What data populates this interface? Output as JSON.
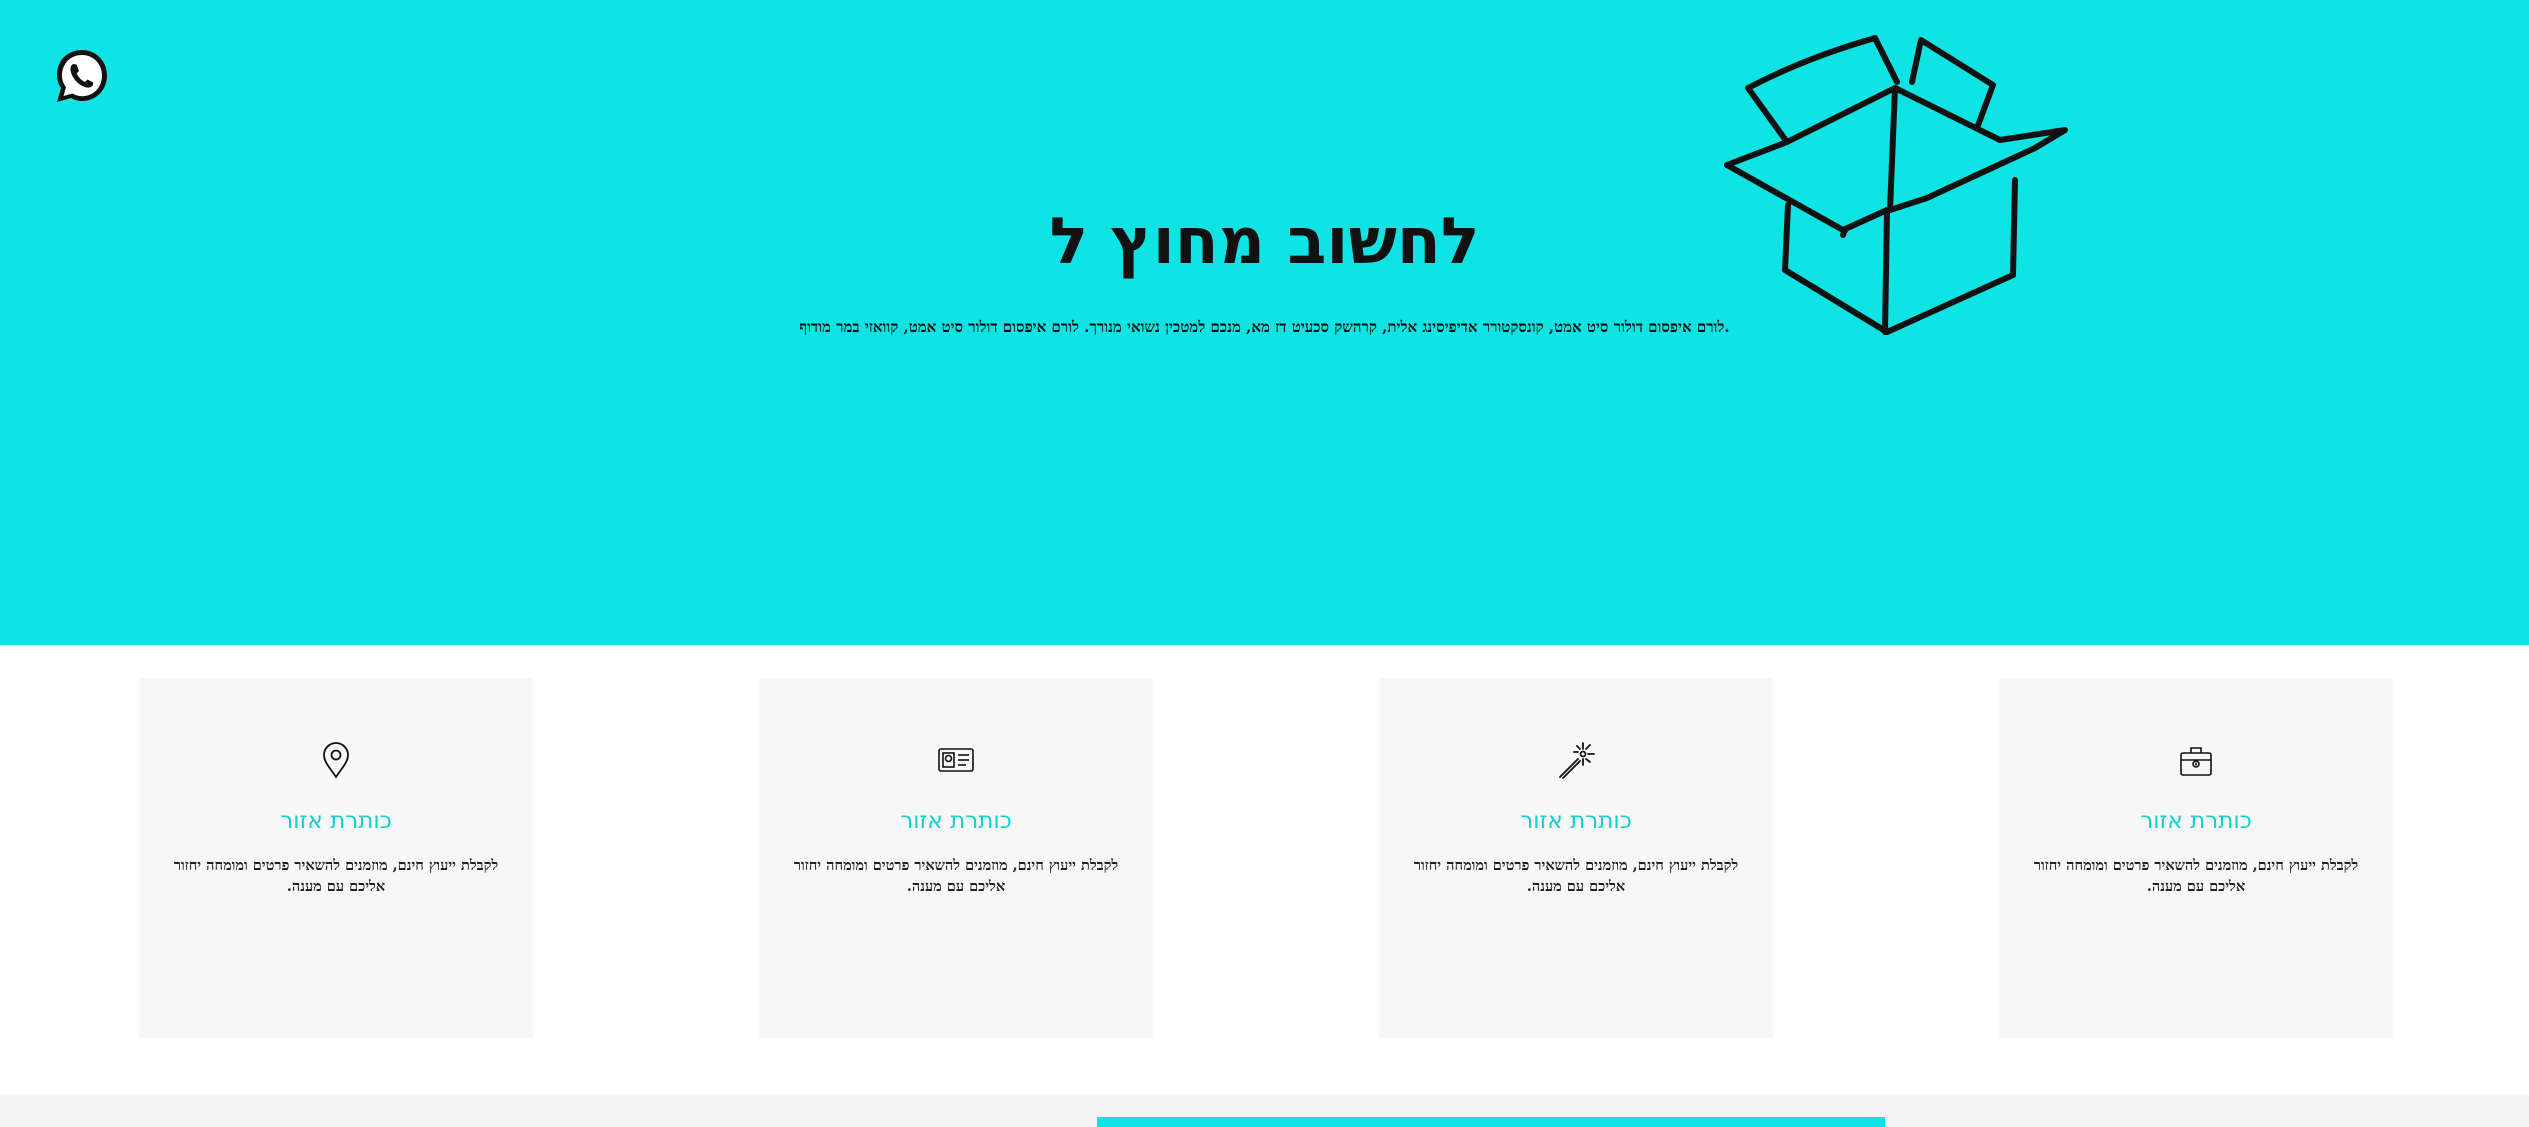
{
  "hero": {
    "title": "לחשוב מחוץ ל",
    "text": "לורם איפסום דולור סיט אמט, קונסקטורר אדיפיסינג אלית, קרהשק סכעיט דז מא, מנכם למטכין נשואי מנורך. לורם איפסום דולור סיט אמט, קוואזי במר מודוף.",
    "icons": {
      "whatsapp": "whatsapp-icon",
      "illustration": "open-box-illustration"
    }
  },
  "cards": [
    {
      "icon": "map-pin-icon",
      "title": "כותרת אזור",
      "text": "לקבלת ייעוץ חינם, מוזמנים להשאיר פרטים ומומחה יחזור אליכם עם מענה."
    },
    {
      "icon": "id-card-icon",
      "title": "כותרת אזור",
      "text": "לקבלת ייעוץ חינם, מוזמנים להשאיר פרטים ומומחה יחזור אליכם עם מענה."
    },
    {
      "icon": "magic-wand-icon",
      "title": "כותרת אזור",
      "text": "לקבלת ייעוץ חינם, מוזמנים להשאיר פרטים ומומחה יחזור אליכם עם מענה."
    },
    {
      "icon": "briefcase-icon",
      "title": "כותרת אזור",
      "text": "לקבלת ייעוץ חינם, מוזמנים להשאיר פרטים ומומחה יחזור אליכם עם מענה."
    }
  ],
  "colors": {
    "accent": "#0fe3e3",
    "card_title": "#13cfd0",
    "card_bg": "#f7f7f7"
  }
}
